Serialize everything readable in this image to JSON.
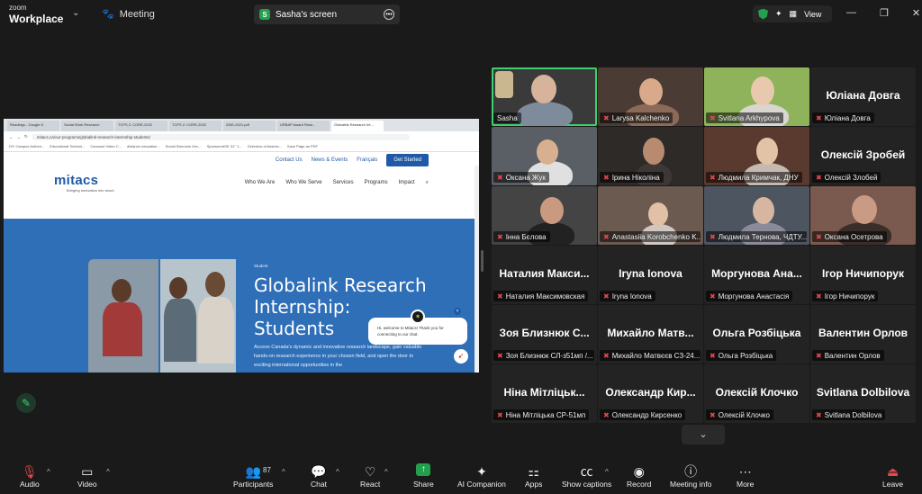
{
  "topbar": {
    "brand_line1": "zoom",
    "brand_line2": "Workplace",
    "meeting_label": "Meeting",
    "share_tab": "Sasha's screen",
    "share_badge": "S",
    "view_label": "View"
  },
  "shared_screen": {
    "tabs": [
      "Readings - Google D",
      "Social Work Research",
      "TCPS 2: CORE-2022",
      "TCPS 2: CORE-2022",
      "ZMG-2021.pdf",
      "URBAP Award Rese...",
      "Globalink Research Int..."
    ],
    "url": "mitacs.ca/our-programs/globalink-research-internship-students/",
    "bookmarks": [
      "DiY Campus Authen...",
      "Educational Technol...",
      "Carousel Video C...",
      "distance education...",
      "Social Sciences Onc...",
      "SponsoredGE 31° 1...",
      "Overview of Assess...",
      "Save Page as PDF"
    ],
    "site_links": [
      "Contact Us",
      "News & Events",
      "Français"
    ],
    "get_started": "Get Started",
    "logo": "mitacs",
    "logo_tagline": "Bringing innovation into reach",
    "nav": [
      "Who We Are",
      "Who We Serve",
      "Services",
      "Programs",
      "Impact"
    ],
    "kicker": "Student",
    "hero_title": "Globalink Research Internship: Students",
    "hero_body": "Access Canada's dynamic and innovative research landscape, gain valuable hands-on research experience in your chosen field, and open the door to exciting international opportunities in the",
    "chat_text": "Hi, welcome to Mitacs! Thank you for connecting to our chat."
  },
  "participants": [
    {
      "name": "Sasha",
      "big": "",
      "video": true,
      "muted": false
    },
    {
      "name": "Larysa Kalchenko",
      "big": "",
      "video": true,
      "muted": true
    },
    {
      "name": "Svitlana Arkhypova",
      "big": "",
      "video": true,
      "muted": true
    },
    {
      "name": "Юліана Довга",
      "big": "Юліана Довга",
      "video": false,
      "muted": true
    },
    {
      "name": "Оксана Жук",
      "big": "",
      "video": true,
      "muted": true
    },
    {
      "name": "Ірина Ніколіна",
      "big": "",
      "video": true,
      "muted": true
    },
    {
      "name": "Людмила Кримчак, ДНУ",
      "big": "",
      "video": true,
      "muted": true
    },
    {
      "name": "Олексій Злобей",
      "big": "Олексій Зробей",
      "video": false,
      "muted": true
    },
    {
      "name": "Інна Бєлова",
      "big": "",
      "video": true,
      "muted": true
    },
    {
      "name": "Anastasiia Korobchenko K...",
      "big": "",
      "video": true,
      "muted": true
    },
    {
      "name": "Людмила Тернова, ЧДТУ...",
      "big": "",
      "video": true,
      "muted": true
    },
    {
      "name": "Оксана Осетрова",
      "big": "",
      "video": true,
      "muted": true
    },
    {
      "name": "Наталия Максимовская",
      "big": "Наталия Макси...",
      "video": false,
      "muted": true
    },
    {
      "name": "Iryna Ionova",
      "big": "Iryna Ionova",
      "video": false,
      "muted": true
    },
    {
      "name": "Моргунова Анастасія",
      "big": "Моргунова Ана...",
      "video": false,
      "muted": true
    },
    {
      "name": "Ігор Ничипорук",
      "big": "Ігор Ничипорук",
      "video": false,
      "muted": true
    },
    {
      "name": "Зоя Близнюк СЛ-з51мп /...",
      "big": "Зоя Близнюк С...",
      "video": false,
      "muted": true
    },
    {
      "name": "Михайло Матвєєв СЗ-24...",
      "big": "Михайло Матв...",
      "video": false,
      "muted": true
    },
    {
      "name": "Ольга Розбіцька",
      "big": "Ольга Розбіцька",
      "video": false,
      "muted": true
    },
    {
      "name": "Валентин Орлов",
      "big": "Валентин Орлов",
      "video": false,
      "muted": true
    },
    {
      "name": "Ніна Мітліцька СР-51мп",
      "big": "Ніна Мітліцьк...",
      "video": false,
      "muted": true
    },
    {
      "name": "Олександр Кирсенко",
      "big": "Олександр Кир...",
      "video": false,
      "muted": true
    },
    {
      "name": "Олексій Клочко",
      "big": "Олексій Клочко",
      "video": false,
      "muted": true
    },
    {
      "name": "Svitlana Dolbilova",
      "big": "Svitlana Dolbilova",
      "video": false,
      "muted": true
    }
  ],
  "toolbar": {
    "audio": "Audio",
    "video": "Video",
    "participants": "Participants",
    "participants_count": "87",
    "chat": "Chat",
    "react": "React",
    "share": "Share",
    "ai": "AI Companion",
    "apps": "Apps",
    "captions": "Show captions",
    "record": "Record",
    "info": "Meeting info",
    "more": "More",
    "leave": "Leave"
  },
  "colors": {
    "accent_green": "#22a04b",
    "active_outline": "#3ecf6e",
    "muted_red": "#e5484d",
    "mitacs_blue": "#2e6fb8"
  }
}
